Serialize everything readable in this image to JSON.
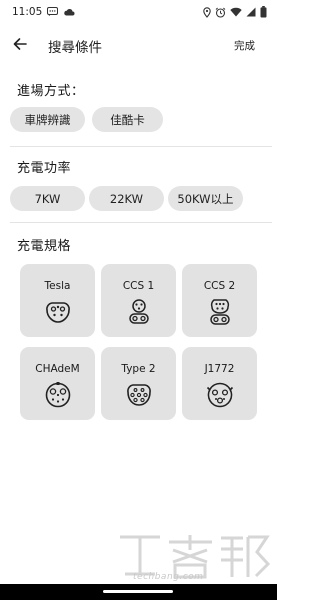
{
  "status_bar": {
    "time": "11:05",
    "left_icons": [
      "message-icon",
      "cloud-icon"
    ],
    "right_icons": [
      "location-icon",
      "alarm-icon",
      "wifi-icon",
      "signal-icon",
      "battery-icon"
    ]
  },
  "header": {
    "title": "搜尋條件",
    "done_label": "完成",
    "back_icon": "arrow-back-icon"
  },
  "entry_method": {
    "title": "進場方式：",
    "options": [
      {
        "label": "車牌辨識"
      },
      {
        "label": "佳酷卡"
      }
    ]
  },
  "charge_power": {
    "title": "充電功率",
    "options": [
      {
        "label": "7KW"
      },
      {
        "label": "22KW"
      },
      {
        "label": "50KW以上"
      }
    ]
  },
  "charge_spec": {
    "title": "充電規格",
    "connectors": [
      {
        "label": "Tesla",
        "icon": "tesla-connector-icon"
      },
      {
        "label": "CCS 1",
        "icon": "ccs1-connector-icon"
      },
      {
        "label": "CCS 2",
        "icon": "ccs2-connector-icon"
      },
      {
        "label": "CHAdeM",
        "icon": "chademo-connector-icon"
      },
      {
        "label": "Type 2",
        "icon": "type2-connector-icon"
      },
      {
        "label": "J1772",
        "icon": "j1772-connector-icon"
      }
    ]
  },
  "watermark": {
    "text": "techbang.com"
  },
  "colors": {
    "pill_bg": "#e4e4e4",
    "card_bg": "#e2e2e2",
    "divider": "#e4e4e4",
    "text": "#1a1a1a"
  }
}
